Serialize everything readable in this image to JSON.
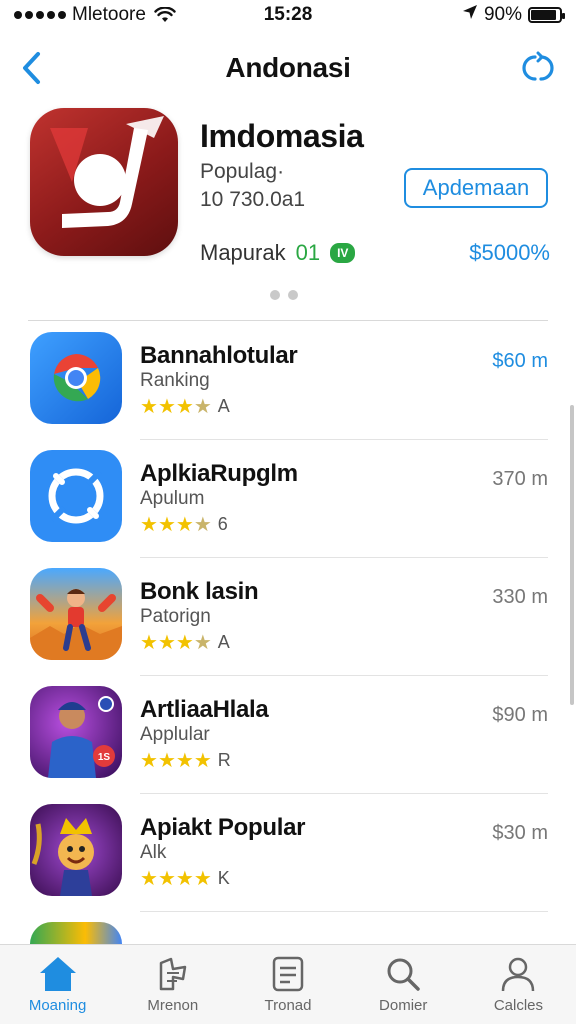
{
  "status": {
    "carrier": "Mletoore",
    "time": "15:28",
    "battery": "90%",
    "battery_level": 0.9
  },
  "nav": {
    "title": "Andonasi"
  },
  "featured": {
    "title": "Imdomasia",
    "subtitle": "Populag·",
    "count": "10 730.0a1",
    "button": "Apdemaan",
    "rank_label": "Mapurak",
    "rank_num": "01",
    "badge": "IV",
    "price": "$5000%"
  },
  "apps": [
    {
      "name": "Bannahlotular",
      "subtitle": "Ranking",
      "rating_label": "A",
      "price": "$60 m",
      "rating": 3.5,
      "icon": "chrome-icon"
    },
    {
      "name": "AplkiaRupglm",
      "subtitle": "Apulum",
      "rating_label": "6",
      "price": "370 m",
      "rating": 3.5,
      "icon": "sync-icon"
    },
    {
      "name": "Bonk lasin",
      "subtitle": "Patorign",
      "rating_label": "A",
      "price": "330 m",
      "rating": 3.5,
      "icon": "runner-game-icon"
    },
    {
      "name": "ArtliaaHlala",
      "subtitle": "Applular",
      "rating_label": "R",
      "price": "$90 m",
      "rating": 4.5,
      "icon": "character-game-icon"
    },
    {
      "name": "Apiakt Popular",
      "subtitle": "Alk",
      "rating_label": "K",
      "price": "$30 m",
      "rating": 4.5,
      "icon": "king-game-icon"
    }
  ],
  "tabs": [
    {
      "label": "Moaning",
      "icon": "home-icon"
    },
    {
      "label": "Mrenon",
      "icon": "games-icon"
    },
    {
      "label": "Tronad",
      "icon": "list-icon"
    },
    {
      "label": "Domier",
      "icon": "search-icon"
    },
    {
      "label": "Calcles",
      "icon": "profile-icon"
    }
  ],
  "colors": {
    "accent": "#1f8de0",
    "star": "#f2c200",
    "badge": "#2aa743"
  }
}
